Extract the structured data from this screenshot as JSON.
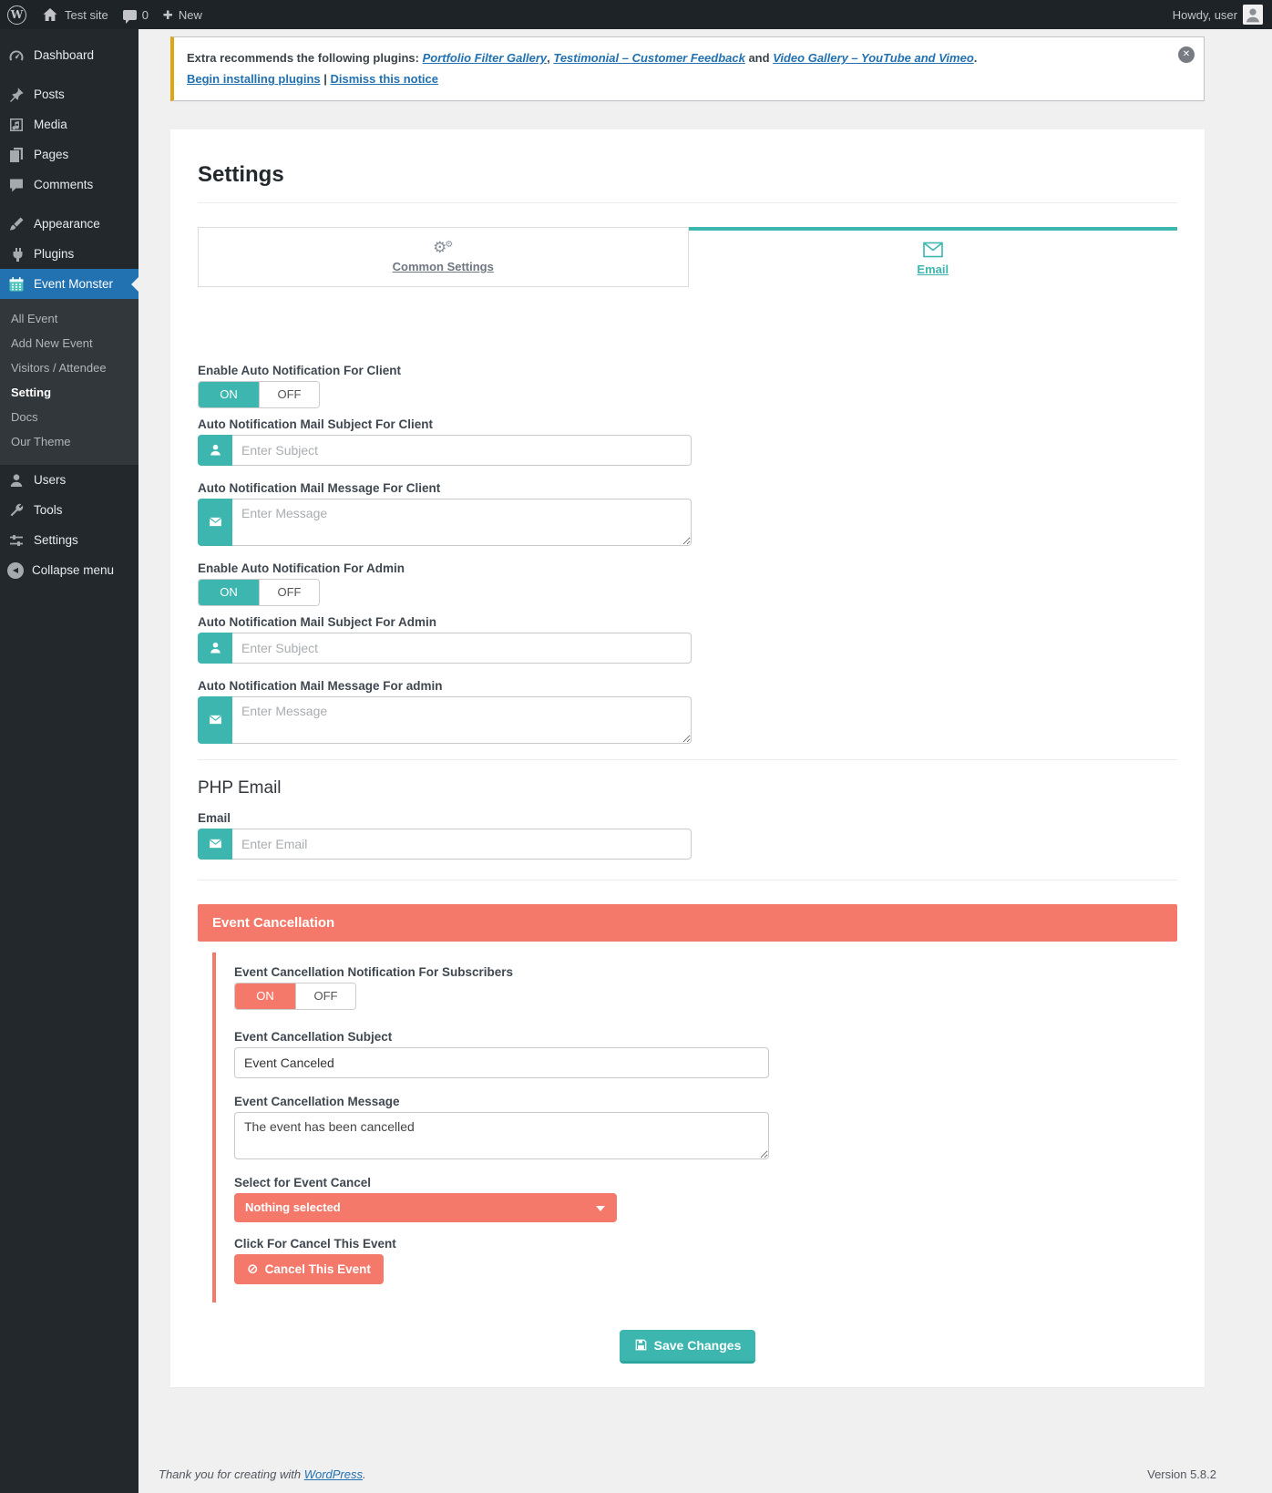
{
  "admin_bar": {
    "site_name": "Test site",
    "comment_count": "0",
    "new_label": "New",
    "howdy": "Howdy, user"
  },
  "icons": {
    "wp": "W",
    "plus": "✚",
    "gear": "⚙",
    "ban": "⊘",
    "close": "✕",
    "collapse_arrow": "◀"
  },
  "sidebar": {
    "items": [
      {
        "label": "Dashboard"
      },
      {
        "label": "Posts"
      },
      {
        "label": "Media"
      },
      {
        "label": "Pages"
      },
      {
        "label": "Comments"
      },
      {
        "label": "Appearance"
      },
      {
        "label": "Plugins"
      },
      {
        "label": "Event Monster"
      },
      {
        "label": "Users"
      },
      {
        "label": "Tools"
      },
      {
        "label": "Settings"
      },
      {
        "label": "Collapse menu"
      }
    ],
    "submenu": [
      {
        "label": "All Event"
      },
      {
        "label": "Add New Event"
      },
      {
        "label": "Visitors / Attendee"
      },
      {
        "label": "Setting"
      },
      {
        "label": "Docs"
      },
      {
        "label": "Our Theme"
      }
    ],
    "active_item": "Event Monster",
    "active_submenu": "Setting"
  },
  "notice": {
    "prefix": "Extra recommends the following plugins: ",
    "plugin1": "Portfolio Filter Gallery",
    "sep1": ", ",
    "plugin2": "Testimonial – Customer Feedback",
    "sep2": " and ",
    "plugin3": "Video Gallery – YouTube and Vimeo",
    "suffix": ".",
    "action_install": "Begin installing plugins",
    "action_sep": "|",
    "action_dismiss": "Dismiss this notice"
  },
  "page": {
    "title": "Settings",
    "tabs": [
      {
        "label": "Common Settings"
      },
      {
        "label": "Email"
      }
    ],
    "active_tab": "Email"
  },
  "form": {
    "client": {
      "toggle_label": "Enable Auto Notification For Client",
      "on": "ON",
      "off": "OFF",
      "toggle_state": "ON",
      "subject_label": "Auto Notification Mail Subject For Client",
      "subject_placeholder": "Enter Subject",
      "message_label": "Auto Notification Mail Message For Client",
      "message_placeholder": "Enter Message"
    },
    "admin": {
      "toggle_label": "Enable Auto Notification For Admin",
      "on": "ON",
      "off": "OFF",
      "toggle_state": "ON",
      "subject_label": "Auto Notification Mail Subject For Admin",
      "subject_placeholder": "Enter Subject",
      "message_label": "Auto Notification Mail Message For admin",
      "message_placeholder": "Enter Message"
    },
    "php_email": {
      "heading": "PHP Email",
      "email_label": "Email",
      "email_placeholder": "Enter Email"
    },
    "cancellation": {
      "header": "Event Cancellation",
      "toggle_label": "Event Cancellation Notification For Subscribers",
      "on": "ON",
      "off": "OFF",
      "toggle_state": "ON",
      "subject_label": "Event Cancellation Subject",
      "subject_value": "Event Canceled",
      "message_label": "Event Cancellation Message",
      "message_value": "The event has been cancelled",
      "select_label": "Select for Event Cancel",
      "select_value": "Nothing selected",
      "cancel_label": "Click For Cancel This Event",
      "cancel_button": "Cancel This Event"
    },
    "save_button": "Save Changes"
  },
  "footer": {
    "thanks_prefix": "Thank you for creating with ",
    "wordpress_link": "WordPress",
    "thanks_suffix": ".",
    "version": "Version 5.8.2"
  },
  "colors": {
    "teal_accent": "#3cb6ae",
    "coral_accent": "#f4796b",
    "wp_blue": "#2271b1",
    "notice_border": "#dba617",
    "adminbar_bg": "#1d2327",
    "sidebar_bg": "#23282d",
    "content_bg": "#f0f0f1"
  }
}
